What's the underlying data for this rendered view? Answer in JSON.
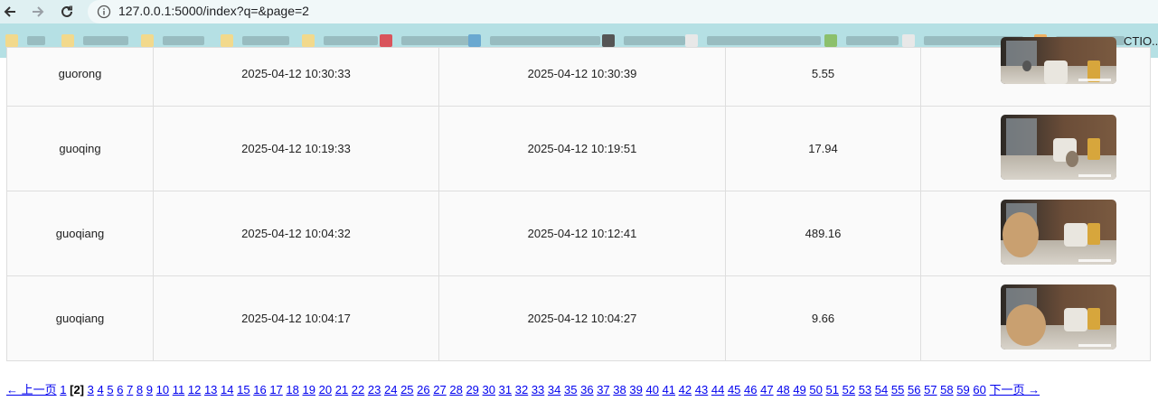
{
  "browser": {
    "url": "127.0.0.1:5000/index?q=&page=2",
    "bookmarks_tail_text": "CTIO..."
  },
  "rows": [
    {
      "name": "guorong",
      "start": "2025-04-12 10:30:33",
      "end": "2025-04-12 10:30:39",
      "value": "5.55"
    },
    {
      "name": "guoqing",
      "start": "2025-04-12 10:19:33",
      "end": "2025-04-12 10:19:51",
      "value": "17.94"
    },
    {
      "name": "guoqiang",
      "start": "2025-04-12 10:04:32",
      "end": "2025-04-12 10:12:41",
      "value": "489.16"
    },
    {
      "name": "guoqiang",
      "start": "2025-04-12 10:04:17",
      "end": "2025-04-12 10:04:27",
      "value": "9.66"
    }
  ],
  "pagination": {
    "prev_label": "← 上一页",
    "next_label": "下一页 →",
    "current_page": 2,
    "last_page": 60,
    "link_color": "#0000ee"
  }
}
